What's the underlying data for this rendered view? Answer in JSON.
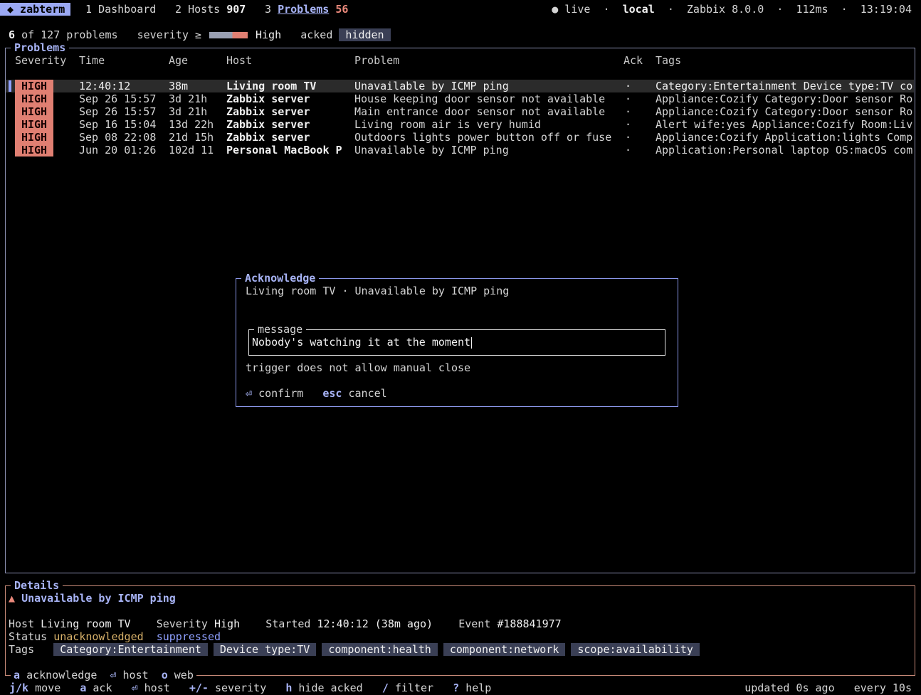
{
  "app": {
    "name": "◆ zabterm"
  },
  "tabs": [
    {
      "num": "1",
      "label": "Dashboard"
    },
    {
      "num": "2",
      "label": "Hosts",
      "count": "907"
    },
    {
      "num": "3",
      "label": "Problems",
      "count": "56"
    }
  ],
  "status": {
    "live": "● live",
    "sep": "·",
    "server": "local",
    "version": "Zabbix 8.0.0",
    "latency": "112ms",
    "clock": "13:19:04"
  },
  "filter": {
    "shown": "6",
    "of": "of 127 problems",
    "severity_label": "severity ≥",
    "severity_value": "High",
    "acked_label": "acked",
    "acked_value": "hidden"
  },
  "problems": {
    "title": "Problems",
    "columns": {
      "severity": "Severity",
      "time": "Time",
      "age": "Age",
      "host": "Host",
      "problem": "Problem",
      "ack": "Ack",
      "tags": "Tags"
    },
    "rows": [
      {
        "severity": "HIGH",
        "time": "12:40:12",
        "age": "38m",
        "host": "Living room TV",
        "problem": "Unavailable by ICMP ping",
        "ack": "·",
        "tags": "Category:Entertainment Device type:TV co"
      },
      {
        "severity": "HIGH",
        "time": "Sep 26 15:57",
        "age": "3d 21h",
        "host": "Zabbix server",
        "problem": "House keeping door sensor not available",
        "ack": "·",
        "tags": "Appliance:Cozify Category:Door sensor Ro"
      },
      {
        "severity": "HIGH",
        "time": "Sep 26 15:57",
        "age": "3d 21h",
        "host": "Zabbix server",
        "problem": "Main entrance door sensor not available",
        "ack": "·",
        "tags": "Appliance:Cozify Category:Door sensor Ro"
      },
      {
        "severity": "HIGH",
        "time": "Sep 16 15:04",
        "age": "13d 22h",
        "host": "Zabbix server",
        "problem": "Living room air is very humid",
        "ack": "·",
        "tags": "Alert wife:yes Appliance:Cozify Room:Liv"
      },
      {
        "severity": "HIGH",
        "time": "Sep 08 22:08",
        "age": "21d 15h",
        "host": "Zabbix server",
        "problem": "Outdoors lights power button off or fuse",
        "ack": "·",
        "tags": "Appliance:Cozify Application:lights Comp"
      },
      {
        "severity": "HIGH",
        "time": "Jun 20 01:26",
        "age": "102d 11",
        "host": "Personal MacBook P",
        "problem": "Unavailable by ICMP ping",
        "ack": "·",
        "tags": "Application:Personal laptop OS:macOS com"
      }
    ]
  },
  "ack_modal": {
    "title": "Acknowledge",
    "subtitle": "Living room TV · Unavailable by ICMP ping",
    "message_label": "message",
    "message_value": "Nobody's watching it at the moment",
    "warning": "trigger does not allow manual close",
    "confirm_key": "⏎",
    "confirm_label": "confirm",
    "cancel_key": "esc",
    "cancel_label": "cancel"
  },
  "details": {
    "title": "Details",
    "heading_icon": "▲",
    "heading": "Unavailable by ICMP ping",
    "host_label": "Host",
    "host": "Living room TV",
    "severity_label": "Severity",
    "severity": "High",
    "started_label": "Started",
    "started": "12:40:12 (38m ago)",
    "event_label": "Event",
    "event": "#188841977",
    "status_label": "Status",
    "status_ack": "unacknowledged",
    "status_supp": "suppressed",
    "tags_label": "Tags",
    "tags": [
      "Category:Entertainment",
      "Device type:TV",
      "component:health",
      "component:network",
      "scope:availability"
    ],
    "actions": [
      {
        "key": "a",
        "label": "acknowledge"
      },
      {
        "key": "⏎",
        "label": "host"
      },
      {
        "key": "o",
        "label": "web"
      }
    ]
  },
  "footer": {
    "hints": [
      {
        "key": "j/k",
        "label": "move"
      },
      {
        "key": "a",
        "label": "ack"
      },
      {
        "key": "⏎",
        "label": "host"
      },
      {
        "key": "+/-",
        "label": "severity"
      },
      {
        "key": "h",
        "label": "hide acked"
      },
      {
        "key": "/",
        "label": "filter"
      },
      {
        "key": "?",
        "label": "help"
      }
    ],
    "updated": "updated 0s ago",
    "interval": "every 10s"
  },
  "colors": {
    "accent": "#9aa8f3",
    "high": "#e07f72",
    "warn": "#d9b26a",
    "chip": "#3a3f55"
  }
}
